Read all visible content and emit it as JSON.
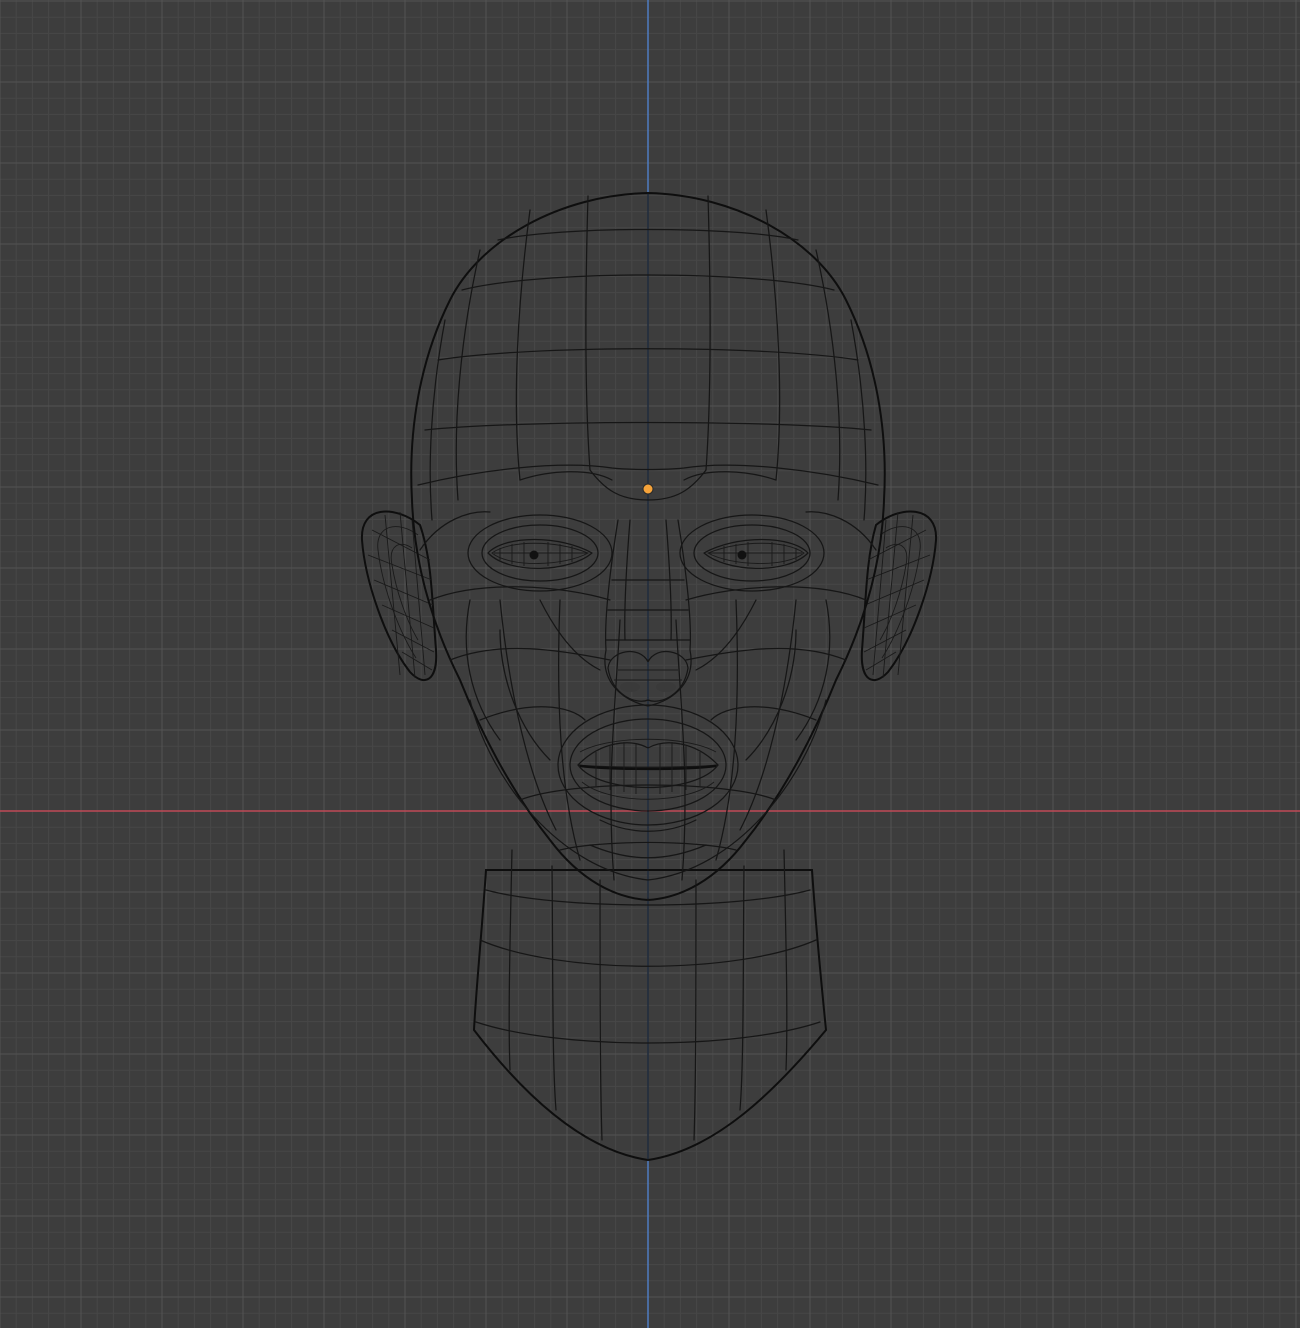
{
  "view": {
    "mode": "front-orthographic",
    "colors": {
      "background": "#3d3d3d",
      "grid_minor": "#474747",
      "grid_major": "#525252",
      "axis_x": "#c04a56",
      "axis_z": "#4e7cc2",
      "mesh_surface": "#a3a3a3",
      "wireframe": "#161616",
      "origin_marker": "#f5a33a"
    }
  },
  "scene": {
    "object": "head-mesh",
    "origin_marker": "object-origin-dot"
  }
}
